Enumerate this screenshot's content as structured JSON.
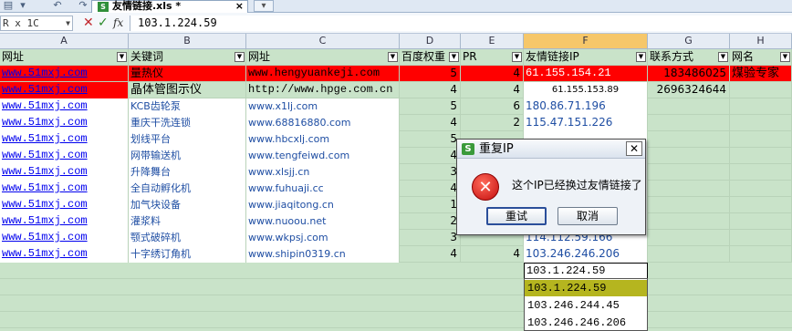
{
  "window": {
    "doc_tab_label": "友情链接.xls *",
    "doc_tab_close": "×",
    "new_tab_label": "▾"
  },
  "formula_bar": {
    "name_box": "R x 1C",
    "cancel_symbol": "✕",
    "confirm_symbol": "✓",
    "fx_label": "fx",
    "value": "103.1.224.59"
  },
  "columns": [
    {
      "letter": "A"
    },
    {
      "letter": "B"
    },
    {
      "letter": "C"
    },
    {
      "letter": "D"
    },
    {
      "letter": "E"
    },
    {
      "letter": "F"
    },
    {
      "letter": "G"
    },
    {
      "letter": "H"
    }
  ],
  "headers": {
    "a": "网址",
    "b": "关键词",
    "c": "网址",
    "d": "百度权重",
    "e": "PR",
    "f": "友情链接IP",
    "g": "联系方式",
    "h": "网名"
  },
  "rows": [
    {
      "a": "www.51mxj.com",
      "b": "量热仪",
      "c": "www.hengyuankeji.com",
      "d": "5",
      "e": "4",
      "f": "61.155.154.21",
      "g": "183486025",
      "h": "煤验专家"
    },
    {
      "a": "www.51mxj.com",
      "b": "晶体管图示仪",
      "c": "http://www.hpge.com.cn",
      "d": "4",
      "e": "4",
      "f": "61.155.153.89",
      "g": "2696324644",
      "h": ""
    },
    {
      "a": "www.51mxj.com",
      "b": "KCB齿轮泵",
      "c": "www.x1lj.com",
      "d": "5",
      "e": "6",
      "f": "180.86.71.196",
      "g": "",
      "h": ""
    },
    {
      "a": "www.51mxj.com",
      "b": "重庆干洗连锁",
      "c": "www.68816880.com",
      "d": "4",
      "e": "2",
      "f": "115.47.151.226",
      "g": "",
      "h": ""
    },
    {
      "a": "www.51mxj.com",
      "b": "划线平台",
      "c": "www.hbcxlj.com",
      "d": "5",
      "e": "",
      "f": "",
      "g": "",
      "h": ""
    },
    {
      "a": "www.51mxj.com",
      "b": "网带输送机",
      "c": "www.tengfeiwd.com",
      "d": "4",
      "e": "",
      "f": "",
      "g": "",
      "h": ""
    },
    {
      "a": "www.51mxj.com",
      "b": "升降舞台",
      "c": "www.xlsjj.cn",
      "d": "3",
      "e": "",
      "f": "",
      "g": "",
      "h": ""
    },
    {
      "a": "www.51mxj.com",
      "b": "全自动孵化机",
      "c": "www.fuhuaji.cc",
      "d": "4",
      "e": "",
      "f": "",
      "g": "",
      "h": ""
    },
    {
      "a": "www.51mxj.com",
      "b": "加气块设备",
      "c": "www.jiaqitong.cn",
      "d": "1",
      "e": "",
      "f": "",
      "g": "",
      "h": ""
    },
    {
      "a": "www.51mxj.com",
      "b": "灌浆料",
      "c": "www.nuoou.net",
      "d": "2",
      "e": "",
      "f": "",
      "g": "",
      "h": ""
    },
    {
      "a": "www.51mxj.com",
      "b": "颚式破碎机",
      "c": "www.wkpsj.com",
      "d": "3",
      "e": "",
      "f": "114.112.59.166",
      "g": "",
      "h": ""
    },
    {
      "a": "www.51mxj.com",
      "b": "十字绣订角机",
      "c": "www.shipin0319.cn",
      "d": "4",
      "e": "4",
      "f": "103.246.246.206",
      "g": "",
      "h": ""
    }
  ],
  "editing_cell_value": "103.1.224.59",
  "dialog": {
    "title": "重复IP",
    "logo_char": "S",
    "close_symbol": "✕",
    "error_symbol": "✕",
    "message": "这个IP已经换过友情链接了",
    "retry_label": "重试",
    "cancel_label": "取消"
  },
  "autocomplete": [
    "103.1.224.59",
    "103.246.244.45",
    "103.246.246.206"
  ],
  "colors": {
    "sheet_background": "#c9e3c9",
    "highlight_red": "#ff0000",
    "autocomplete_selected": "#b5b51f",
    "selected_column_header": "#f6c76a"
  },
  "icons": [
    "print-icon",
    "undo-icon",
    "redo-icon",
    "xls-file-icon",
    "new-tab-icon",
    "cancel-edit-icon",
    "confirm-edit-icon",
    "function-icon",
    "filter-arrow-icon",
    "error-icon",
    "close-icon",
    "app-logo-icon"
  ]
}
